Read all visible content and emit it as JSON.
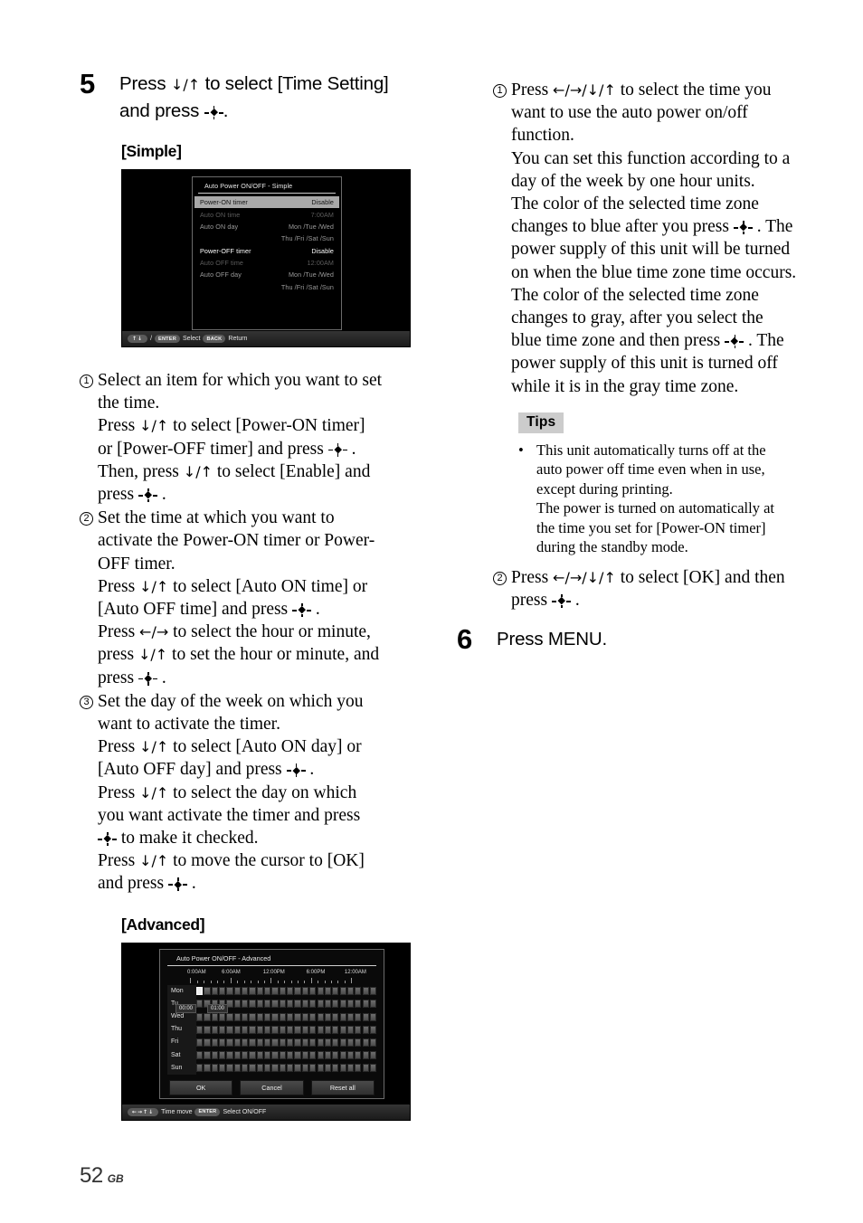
{
  "page": {
    "number": "52",
    "region": "GB"
  },
  "left": {
    "step5": {
      "number": "5",
      "line1_a": "Press ",
      "line1_arrows": "↓/↑",
      "line1_b": " to select [Time Setting]",
      "line2_a": "and press ",
      "line2_b": "."
    },
    "simple_heading": "[Simple]",
    "advanced_heading": "[Advanced]",
    "items": [
      {
        "marker": "1",
        "lines": [
          "Select an item for which you want to set",
          "the time.",
          "Press ↓/↑ to select [Power-ON timer]",
          "or [Power-OFF timer] and press -♦- .",
          "Then, press ↓/↑ to select [Enable] and",
          "press -♦- ."
        ]
      },
      {
        "marker": "2",
        "lines": [
          "Set the time at which you want to",
          "activate the Power-ON timer or Power-",
          "OFF timer.",
          "Press ↓/↑ to select [Auto ON time] or",
          "[Auto OFF time] and press -♦- .",
          "Press ←/→ to select the hour or minute,",
          "press ↓/↑ to set the hour or minute, and",
          "press -♦- ."
        ]
      },
      {
        "marker": "3",
        "lines": [
          "Set the day of the week on which you",
          "want to activate the timer.",
          "Press ↓/↑ to select [Auto ON day] or",
          "[Auto OFF day] and press -♦- .",
          "Press ↓/↑ to select the day on which",
          "you want activate the timer and press",
          "-♦- to make it checked.",
          "Press ↓/↑ to move the cursor to [OK]",
          "and press -♦- ."
        ]
      }
    ]
  },
  "right": {
    "item1": {
      "marker": "1",
      "lines": [
        "Press ←/→/↓/↑ to select the time you",
        "want to use the auto power on/off",
        "function.",
        "You can set this function according to a",
        "day of the week by one hour units.",
        "The color of the selected time zone",
        "changes to blue after you press -♦- . The",
        "power supply of this unit will be turned",
        "on when the blue time zone time occurs.",
        "The color of the selected time zone",
        "changes to gray, after you select the",
        "blue time zone and then press -♦- . The",
        "power supply of this unit is turned off",
        "while it is in the gray time zone."
      ]
    },
    "tips": {
      "label": "Tips",
      "bullet": "•",
      "lines": [
        "This unit automatically turns off at the",
        "auto power off time even when in use,",
        "except during printing.",
        "The power is turned on automatically at",
        "the time you set for [Power-ON timer]",
        "during the standby mode."
      ]
    },
    "item2": {
      "marker": "2",
      "lines": [
        "Press ←/→/↓/↑ to select [OK] and then",
        "press -♦- ."
      ]
    },
    "step6": {
      "number": "6",
      "text": "Press MENU."
    }
  },
  "osd_simple": {
    "title": "Auto Power ON/OFF - Simple",
    "rows": [
      {
        "label": "Power-ON timer",
        "value": "Disable",
        "style": "highlight"
      },
      {
        "label": "Auto ON time",
        "value": "7:00AM",
        "style": "dim"
      },
      {
        "label": "Auto ON day",
        "value": "Mon /Tue /Wed",
        "style": "mid"
      },
      {
        "label": "",
        "value": "Thu /Fri /Sat /Sun",
        "style": "mid"
      },
      {
        "label": "Power-OFF timer",
        "value": "Disable",
        "style": "bright"
      },
      {
        "label": "Auto OFF time",
        "value": "12:00AM",
        "style": "dim"
      },
      {
        "label": "Auto OFF day",
        "value": "Mon /Tue /Wed",
        "style": "mid"
      },
      {
        "label": "",
        "value": "Thu /Fri /Sat /Sun",
        "style": "mid"
      }
    ],
    "bottombar": {
      "arrows_key": "↑↓",
      "slash": "/",
      "enter_key": "ENTER",
      "select_text": "Select",
      "back_key": "BACK",
      "return_text": "Return"
    }
  },
  "osd_advanced": {
    "title": "Auto Power ON/OFF - Advanced",
    "time_labels": [
      "0:00AM",
      "6:00AM",
      "12:00PM",
      "6:00PM",
      "12:00AM"
    ],
    "days": [
      "Mon",
      "Tu.",
      "Wed",
      "Thu",
      "Fri",
      "Sat",
      "Sun"
    ],
    "selected_cell": {
      "day": "Mon",
      "index": 0
    },
    "tooltip_start": "00:00",
    "tooltip_end": "01:00",
    "buttons": [
      "OK",
      "Cancel",
      "Reset all"
    ],
    "bottombar": {
      "arrows_key": "←→↑↓",
      "timemove_text": "Time move",
      "enter_key": "ENTER",
      "select_text": "Select ON/OFF"
    }
  }
}
